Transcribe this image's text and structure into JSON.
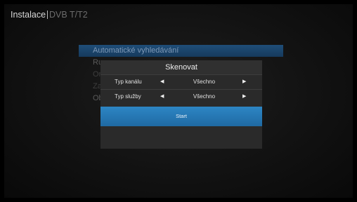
{
  "header": {
    "title": "Instalace",
    "subtitle": "DVB T/T2"
  },
  "background_menu": {
    "items": [
      {
        "label": "Automatické vyhledávání"
      },
      {
        "label": "Ru"
      },
      {
        "label": "Or"
      },
      {
        "label": "Za"
      },
      {
        "label": "Ob"
      }
    ]
  },
  "dialog": {
    "title": "Skenovat",
    "options": [
      {
        "label": "Typ kanálu",
        "value": "Všechno"
      },
      {
        "label": "Typ služby",
        "value": "Všechno"
      }
    ],
    "start_label": "Start"
  },
  "colors": {
    "accent": "#2d86c4",
    "highlight": "#1f4e79"
  }
}
